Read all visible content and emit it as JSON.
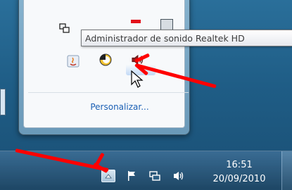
{
  "tray_popup": {
    "customize_link": "Personalizar...",
    "icons": [
      "network-icon",
      "red-app-icon",
      "dark-app-icon",
      "java-icon",
      "circle-app-icon",
      "speaker-icon"
    ]
  },
  "tooltip": {
    "text": "Administrador de sonido Realtek HD"
  },
  "taskbar": {
    "time": "16:51",
    "date": "20/09/2010",
    "icons": [
      "show-hidden-icons-button",
      "action-center-flag-icon",
      "network-icon",
      "volume-icon"
    ]
  },
  "colors": {
    "arrow": "#ff0000",
    "link": "#1a5fb4",
    "desktop": "#1f5d86"
  }
}
